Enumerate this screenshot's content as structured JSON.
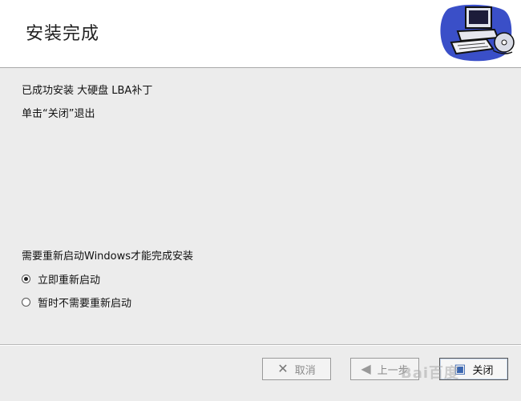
{
  "header": {
    "title": "安装完成",
    "icon": "computer-disc-icon"
  },
  "content": {
    "line1": "已成功安装 大硬盘 LBA补丁",
    "line2": "单击“关闭”退出",
    "restart_prompt": "需要重新启动Windows才能完成安装",
    "options": [
      {
        "label": "立即重新启动",
        "selected": true
      },
      {
        "label": "暂时不需要重新启动",
        "selected": false
      }
    ]
  },
  "footer": {
    "cancel_label": "取消",
    "back_label": "上一步",
    "close_label": "关闭"
  },
  "watermark": "Bai百度"
}
